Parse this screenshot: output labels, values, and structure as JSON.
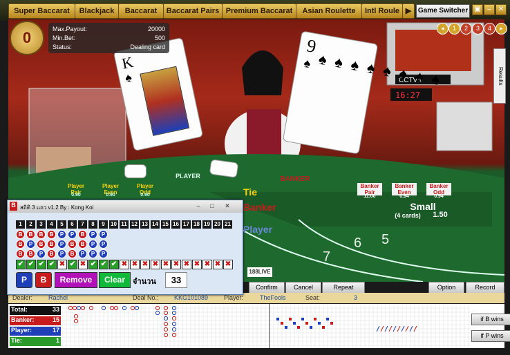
{
  "game_tabs": [
    "Super Baccarat",
    "Blackjack",
    "Baccarat",
    "Baccarat Pairs",
    "Premium Baccarat",
    "Asian Roulette",
    "Intl Roule"
  ],
  "game_switcher": "Game Switcher",
  "counter": "0",
  "info": {
    "max_payout_label": "Max.Payout:",
    "max_payout": "20000",
    "min_bet_label": "Min.Bet:",
    "min_bet": "500",
    "status_label": "Status:",
    "status": "Dealing card"
  },
  "rounds": [
    "1",
    "2",
    "3",
    "4"
  ],
  "results_label": "Results",
  "tv_text": "CCTV4",
  "tv_time": "16:27",
  "table": {
    "player_pair": "Player Pair",
    "player_even": "Player Even",
    "player_odd": "Player Odd",
    "banker_pair": "Banker Pair",
    "banker_even": "Banker Even",
    "banker_odd": "Banker Odd",
    "tie": "Tie",
    "banker": "Banker",
    "player": "Player",
    "small": "Small",
    "small_sub": "(4 cards)",
    "small_odds": "1.50",
    "banker_pair_odds": "11.00",
    "banker_even_odds": "0.94",
    "banker_odd_odds": "0.94",
    "pp_odds": "0.90",
    "pe_odds": "0.90",
    "po_odds": "0.90",
    "banker_text": "BANKER",
    "player_text": "PLAYER",
    "live_logo": "188LIVE"
  },
  "controls": {
    "confirm": "Confirm",
    "cancel": "Cancel",
    "repeat": "Repeat",
    "option": "Option",
    "record": "Record"
  },
  "strip": {
    "dealer_label": "Dealer:",
    "dealer": "Rachel",
    "deal_no_label": "Deal No.:",
    "deal_no": "KKG101089",
    "player_label": "Player:",
    "player": "TheFools",
    "seat_label": "Seat:",
    "seat": "3"
  },
  "stats": [
    {
      "label": "Total:",
      "value": "33",
      "color": "#111111"
    },
    {
      "label": "Banker:",
      "value": "15",
      "color": "#c81c1c"
    },
    {
      "label": "Player:",
      "value": "17",
      "color": "#1e3fb8"
    },
    {
      "label": "Tie:",
      "value": "1",
      "color": "#2a9a2a"
    }
  ],
  "if_buttons": [
    "if B wins",
    "if P wins"
  ],
  "app": {
    "title": "สถิติ 3 แถว v1.2 By : Kong Koi",
    "columns": [
      "1",
      "2",
      "3",
      "4",
      "5",
      "6",
      "7",
      "8",
      "9",
      "10",
      "11",
      "12",
      "13",
      "14",
      "15",
      "16",
      "17",
      "18",
      "19",
      "20",
      "21"
    ],
    "row1": [
      "B",
      "B",
      "B",
      "B",
      "P",
      "P",
      "B",
      "P",
      "P"
    ],
    "row2": [
      "B",
      "P",
      "B",
      "B",
      "P",
      "B",
      "B",
      "P",
      "P"
    ],
    "row3": [
      "B",
      "B",
      "P",
      "B",
      "P",
      "B",
      "P",
      "P",
      "P"
    ],
    "checks": [
      "v",
      "v",
      "v",
      "v",
      "x",
      "v",
      "x",
      "v",
      "v",
      "v",
      "x",
      "x",
      "x",
      "x",
      "x",
      "x",
      "x",
      "x",
      "x",
      "x",
      "x"
    ],
    "p_label": "P",
    "b_label": "B",
    "remove_label": "Remove",
    "clear_label": "Clear",
    "count_label": "จำนวน",
    "count_value": "33"
  },
  "colors": {
    "banker": "#c81c1c",
    "player": "#1e3fb8",
    "tie": "#2a9a2a",
    "gold": "#d4a52a"
  }
}
